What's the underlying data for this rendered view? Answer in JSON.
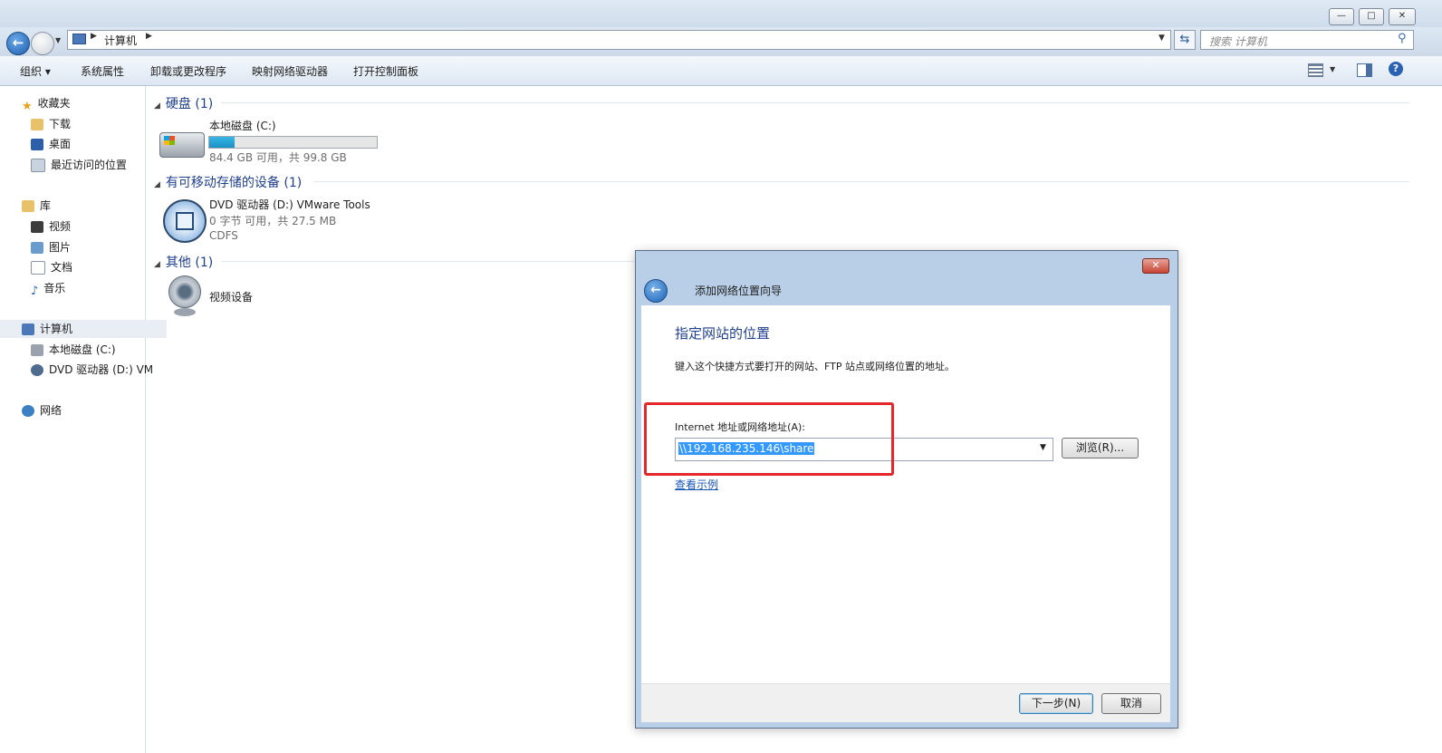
{
  "window": {
    "minimize": "—",
    "maximize": "□",
    "close": "✕"
  },
  "address": {
    "path_root": "计算机",
    "search_placeholder": "搜索 计算机"
  },
  "toolbar": {
    "organize": "组织 ▾",
    "system_properties": "系统属性",
    "uninstall": "卸载或更改程序",
    "map_drive": "映射网络驱动器",
    "control_panel": "打开控制面板"
  },
  "nav": {
    "favorites": "收藏夹",
    "downloads": "下载",
    "desktop": "桌面",
    "recent": "最近访问的位置",
    "libraries": "库",
    "videos": "视频",
    "pictures": "图片",
    "documents": "文档",
    "music": "音乐",
    "computer": "计算机",
    "local_disk": "本地磁盘 (C:)",
    "dvd": "DVD 驱动器 (D:) VM",
    "network": "网络"
  },
  "content": {
    "hdd_header": "硬盘 (1)",
    "local_disk_name": "本地磁盘 (C:)",
    "local_disk_space": "84.4 GB 可用，共 99.8 GB",
    "local_disk_used_fraction": 0.15,
    "removable_header": "有可移动存储的设备 (1)",
    "dvd_name": "DVD 驱动器 (D:) VMware Tools",
    "dvd_space": "0 字节 可用，共 27.5 MB",
    "dvd_fs": "CDFS",
    "other_header": "其他 (1)",
    "video_device": "视频设备"
  },
  "dialog": {
    "title": "添加网络位置向导",
    "heading": "指定网站的位置",
    "instruction": "键入这个快捷方式要打开的网站、FTP 站点或网络位置的地址。",
    "field_label": "Internet 地址或网络地址(A):",
    "field_value": "\\\\192.168.235.146\\share",
    "browse": "浏览(R)...",
    "example_link": "查看示例",
    "next": "下一步(N)",
    "cancel": "取消",
    "close": "✕"
  }
}
